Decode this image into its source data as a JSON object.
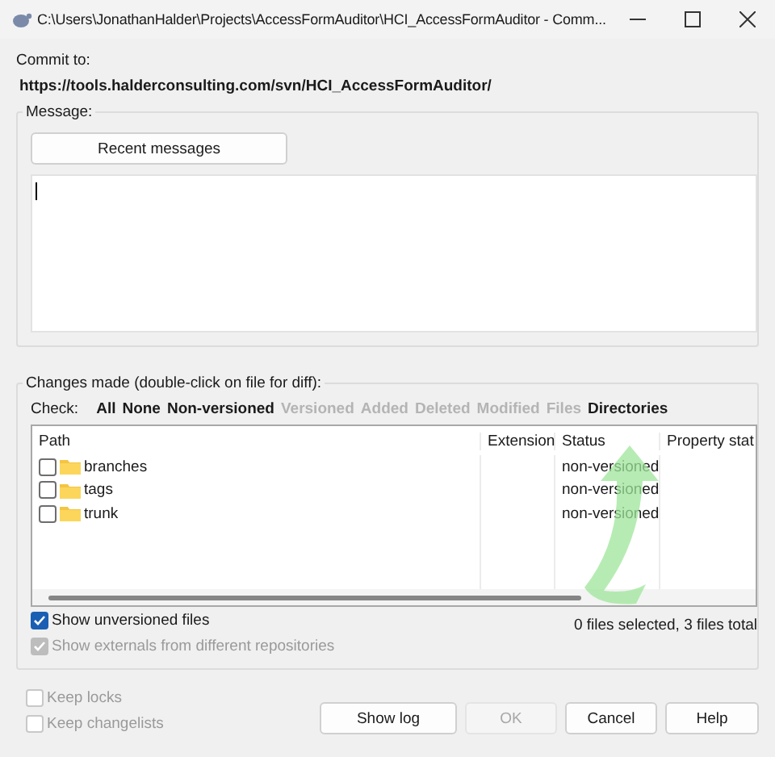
{
  "window": {
    "title": "C:\\Users\\JonathanHalder\\Projects\\AccessFormAuditor\\HCI_AccessFormAuditor - Comm..."
  },
  "commit_to": {
    "label": "Commit to:",
    "url": "https://tools.halderconsulting.com/svn/HCI_AccessFormAuditor/"
  },
  "message": {
    "label": "Message:",
    "recent_button": "Recent messages"
  },
  "changes": {
    "label": "Changes made (double-click on file for diff):",
    "check_label": "Check:",
    "filters": [
      {
        "label": "All",
        "disabled": false
      },
      {
        "label": "None",
        "disabled": false
      },
      {
        "label": "Non-versioned",
        "disabled": false
      },
      {
        "label": "Versioned",
        "disabled": true
      },
      {
        "label": "Added",
        "disabled": true
      },
      {
        "label": "Deleted",
        "disabled": true
      },
      {
        "label": "Modified",
        "disabled": true
      },
      {
        "label": "Files",
        "disabled": true
      },
      {
        "label": "Directories",
        "disabled": false
      }
    ],
    "columns": [
      "Path",
      "Extension",
      "Status",
      "Property stat"
    ],
    "rows": [
      {
        "path": "branches",
        "status": "non-versioned",
        "checked": false
      },
      {
        "path": "tags",
        "status": "non-versioned",
        "checked": false
      },
      {
        "path": "trunk",
        "status": "non-versioned",
        "checked": false
      }
    ],
    "summary": "0 files selected, 3 files total",
    "options": [
      {
        "label": "Show unversioned files",
        "checked": true,
        "disabled": false
      },
      {
        "label": "Show externals from different repositories",
        "checked": true,
        "disabled": true
      }
    ]
  },
  "bottom_options": [
    {
      "label": "Keep locks",
      "checked": false,
      "disabled": true
    },
    {
      "label": "Keep changelists",
      "checked": false,
      "disabled": true
    }
  ],
  "buttons": [
    {
      "label": "Show log",
      "disabled": false
    },
    {
      "label": "OK",
      "disabled": true
    },
    {
      "label": "Cancel",
      "disabled": false
    },
    {
      "label": "Help",
      "disabled": false
    }
  ]
}
